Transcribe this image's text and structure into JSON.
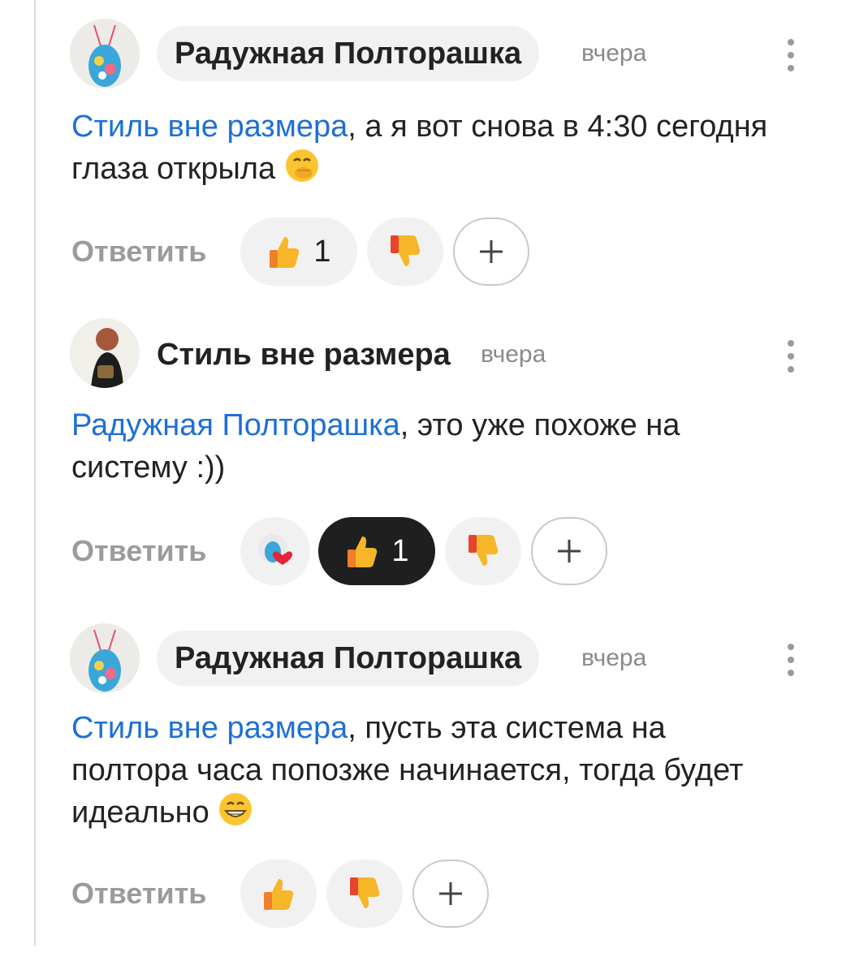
{
  "comments": [
    {
      "author": "Радужная Полторашка",
      "time": "вчера",
      "mention": "Стиль вне размера",
      "text": ", а я вот снова в 4:30 сегодня глаза открыла",
      "emoji": "face-with-hand-over-mouth",
      "reply_label": "Ответить",
      "likes": "1"
    },
    {
      "author": "Стиль вне размера",
      "time": "вчера",
      "mention": "Радужная Полторашка",
      "text": ", это уже похоже на систему :))",
      "reply_label": "Ответить",
      "likes": "1"
    },
    {
      "author": "Радужная Полторашка",
      "time": "вчера",
      "mention": "Стиль вне размера",
      "text": ", пусть эта система на полтора часа попозже начинается, тогда будет идеально",
      "emoji": "grinning-face",
      "reply_label": "Ответить"
    }
  ],
  "colors": {
    "link": "#1e6fd6",
    "muted": "#9b9b9b",
    "chip_bg": "#f1f1f1",
    "chip_active": "#1f1f1f"
  }
}
